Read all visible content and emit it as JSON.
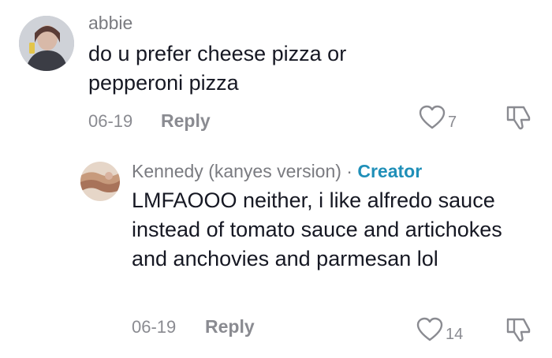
{
  "comments": [
    {
      "username": "abbie",
      "text": "do u prefer cheese pizza or pepperoni pizza",
      "date": "06-19",
      "reply_label": "Reply",
      "likes": "7"
    },
    {
      "username": "Kennedy (kanyes version)",
      "separator": " · ",
      "badge": "Creator",
      "text": "LMFAOOO neither, i like alfredo sauce instead of tomato sauce and artichokes and anchovies and parmesan lol",
      "date": "06-19",
      "reply_label": "Reply",
      "likes": "14"
    }
  ],
  "icons": {
    "like": "heart-outline-icon",
    "dislike": "thumbs-down-outline-icon"
  },
  "colors": {
    "creator_badge": "#1f8fb8",
    "muted": "#8a8b91",
    "text": "#161823"
  }
}
